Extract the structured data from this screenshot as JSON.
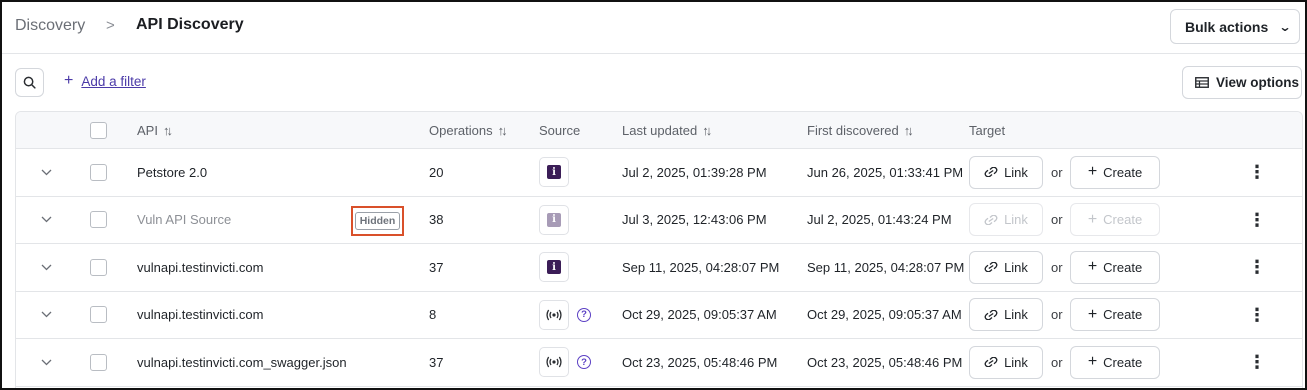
{
  "breadcrumb": {
    "root": "Discovery",
    "separator": ">",
    "current": "API Discovery"
  },
  "header": {
    "bulk_actions_label": "Bulk actions"
  },
  "toolbar": {
    "add_filter_label": "Add a filter",
    "view_options_label": "View options"
  },
  "table": {
    "columns": {
      "api": "API",
      "operations": "Operations",
      "source": "Source",
      "last_updated": "Last updated",
      "first_discovered": "First discovered",
      "target": "Target"
    },
    "rows": [
      {
        "api": "Petstore 2.0",
        "hidden": false,
        "badge": "",
        "operations": "20",
        "source_type": "info",
        "last_updated": "Jul 2, 2025, 01:39:28 PM",
        "first_discovered": "Jun 26, 2025, 01:33:41 PM",
        "link_label": "Link",
        "or_label": "or",
        "create_label": "Create"
      },
      {
        "api": "Vuln API Source",
        "hidden": true,
        "badge": "Hidden",
        "operations": "38",
        "source_type": "info",
        "last_updated": "Jul 3, 2025, 12:43:06 PM",
        "first_discovered": "Jul 2, 2025, 01:43:24 PM",
        "link_label": "Link",
        "or_label": "or",
        "create_label": "Create"
      },
      {
        "api": "vulnapi.testinvicti.com",
        "hidden": false,
        "badge": "",
        "operations": "37",
        "source_type": "info",
        "last_updated": "Sep 11, 2025, 04:28:07 PM",
        "first_discovered": "Sep 11, 2025, 04:28:07 PM",
        "link_label": "Link",
        "or_label": "or",
        "create_label": "Create"
      },
      {
        "api": "vulnapi.testinvicti.com",
        "hidden": false,
        "badge": "",
        "operations": "8",
        "source_type": "traffic",
        "last_updated": "Oct 29, 2025, 09:05:37 AM",
        "first_discovered": "Oct 29, 2025, 09:05:37 AM",
        "link_label": "Link",
        "or_label": "or",
        "create_label": "Create"
      },
      {
        "api": "vulnapi.testinvicti.com_swagger.json",
        "hidden": false,
        "badge": "",
        "operations": "37",
        "source_type": "traffic",
        "last_updated": "Oct 23, 2025, 05:48:46 PM",
        "first_discovered": "Oct 23, 2025, 05:48:46 PM",
        "link_label": "Link",
        "or_label": "or",
        "create_label": "Create"
      }
    ]
  },
  "icons": {
    "search": "search-icon",
    "plus": "plus-icon",
    "chevron": "chevron-down-icon",
    "table": "table-icon",
    "sort": "sort-icon",
    "info": "info-icon",
    "traffic": "broadcast-icon",
    "help": "help-icon",
    "link": "link-icon",
    "kebab": "more-vertical-icon"
  },
  "colors": {
    "accent": "#4b3aa8",
    "source_icon": "#3b1d57",
    "highlight": "#d9502a"
  }
}
